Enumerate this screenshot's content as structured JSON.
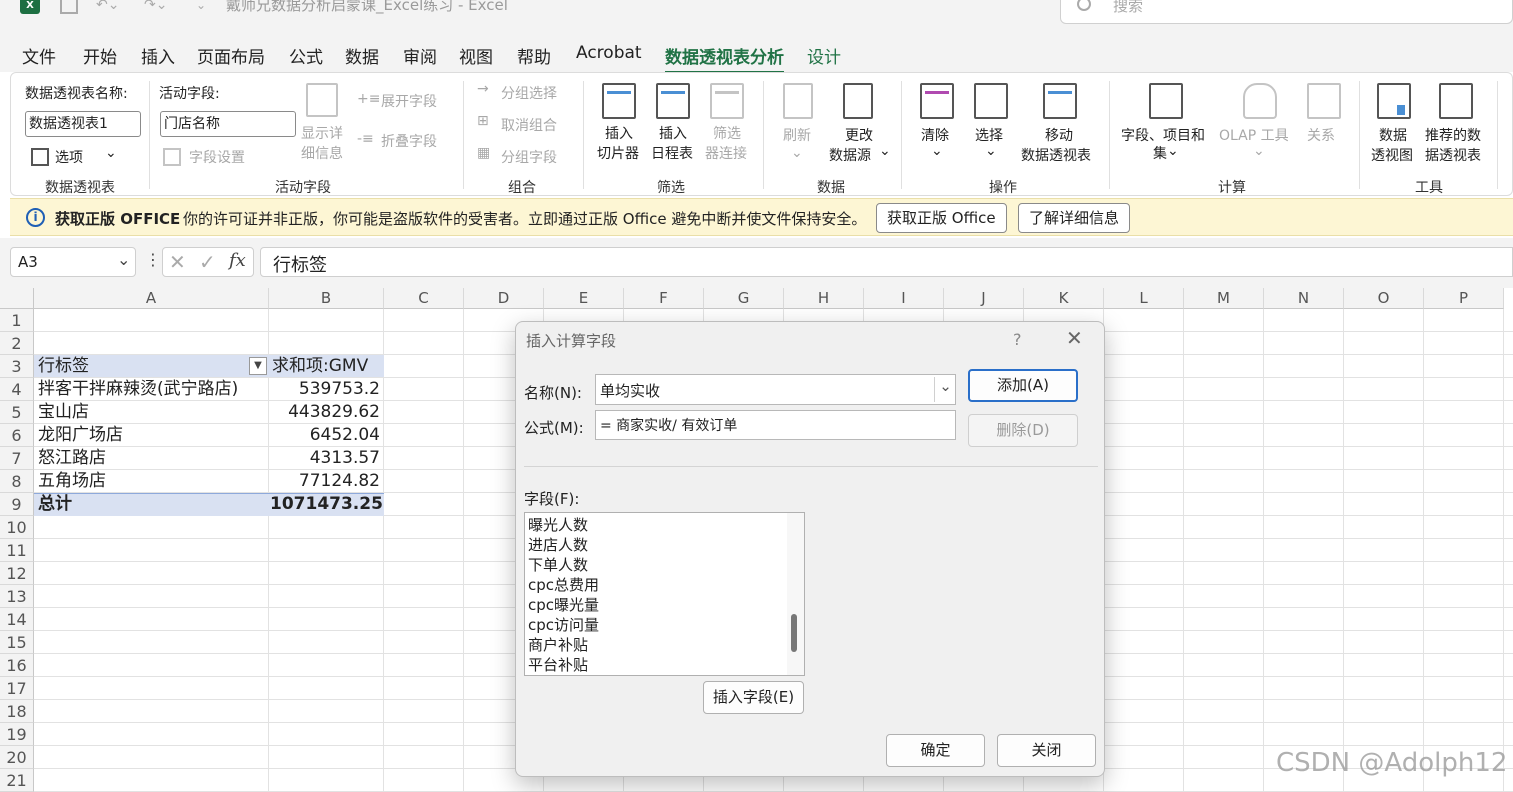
{
  "title_bar": {
    "title": "戴师兄数据分析启蒙课_Excel练习 - Excel",
    "search_placeholder": "搜索"
  },
  "menu_tabs": [
    "文件",
    "开始",
    "插入",
    "页面布局",
    "公式",
    "数据",
    "审阅",
    "视图",
    "帮助",
    "Acrobat",
    "数据透视表分析",
    "设计"
  ],
  "ribbon": {
    "pivot_name_label": "数据透视表名称:",
    "pivot_name_value": "数据透视表1",
    "options_label": "选项",
    "group_pivot": "数据透视表",
    "active_field_label": "活动字段:",
    "active_field_value": "门店名称",
    "field_settings": "字段设置",
    "show_detail_1": "显示详",
    "show_detail_2": "细信息",
    "expand_field": "展开字段",
    "collapse_field": "折叠字段",
    "group_active_field": "活动字段",
    "group_selection": "分组选择",
    "ungroup": "取消组合",
    "group_field": "分组字段",
    "group_group": "组合",
    "insert_slicer_1": "插入",
    "insert_slicer_2": "切片器",
    "insert_timeline_1": "插入",
    "insert_timeline_2": "日程表",
    "filter_conn_1": "筛选",
    "filter_conn_2": "器连接",
    "group_filter": "筛选",
    "refresh": "刷新",
    "change_source_1": "更改",
    "change_source_2": "数据源",
    "group_data": "数据",
    "clear": "清除",
    "select": "选择",
    "move_1": "移动",
    "move_2": "数据透视表",
    "group_actions": "操作",
    "fields_items_1": "字段、项目和",
    "fields_items_2": "集",
    "olap_tools": "OLAP 工具",
    "relationships": "关系",
    "group_calc": "计算",
    "pivotchart_1": "数据",
    "pivotchart_2": "透视图",
    "recommended_1": "推荐的数",
    "recommended_2": "据透视表",
    "group_tools": "工具"
  },
  "notice": {
    "title": "获取正版 OFFICE",
    "message": "你的许可证并非正版，你可能是盗版软件的受害者。立即通过正版 Office 避免中断并使文件保持安全。",
    "btn_genuine": "获取正版 Office",
    "btn_learn": "了解详细信息"
  },
  "formula_bar": {
    "name_box": "A3",
    "content": "行标签"
  },
  "columns": [
    "A",
    "B",
    "C",
    "D",
    "E",
    "F",
    "G",
    "H",
    "I",
    "J",
    "K",
    "L",
    "M",
    "N",
    "O",
    "P"
  ],
  "rows": [
    "1",
    "2",
    "3",
    "4",
    "5",
    "6",
    "7",
    "8",
    "9",
    "10",
    "11",
    "12",
    "13",
    "14",
    "15",
    "16",
    "17",
    "18",
    "19",
    "20",
    "21"
  ],
  "pivot_table": {
    "header_label": "行标签",
    "header_value": "求和项:GMV",
    "rows": [
      {
        "label": "拌客干拌麻辣烫(武宁路店)",
        "value": "539753.2"
      },
      {
        "label": "宝山店",
        "value": "443829.62"
      },
      {
        "label": "龙阳广场店",
        "value": "6452.04"
      },
      {
        "label": "怒江路店",
        "value": "4313.57"
      },
      {
        "label": "五角场店",
        "value": "77124.82"
      }
    ],
    "total_label": "总计",
    "total_value": "1071473.25"
  },
  "dialog": {
    "title": "插入计算字段",
    "help": "?",
    "name_label": "名称(N):",
    "name_value": "单均实收",
    "formula_label": "公式(M):",
    "formula_value": "= 商家实收/ 有效订单",
    "add_btn": "添加(A)",
    "delete_btn": "删除(D)",
    "fields_label": "字段(F):",
    "fields": [
      "曝光人数",
      "进店人数",
      "下单人数",
      "cpc总费用",
      "cpc曝光量",
      "cpc访问量",
      "商户补贴",
      "平台补贴"
    ],
    "insert_field_btn": "插入字段(E)",
    "ok_btn": "确定",
    "close_btn": "关闭"
  },
  "watermark": "CSDN @Adolph12"
}
